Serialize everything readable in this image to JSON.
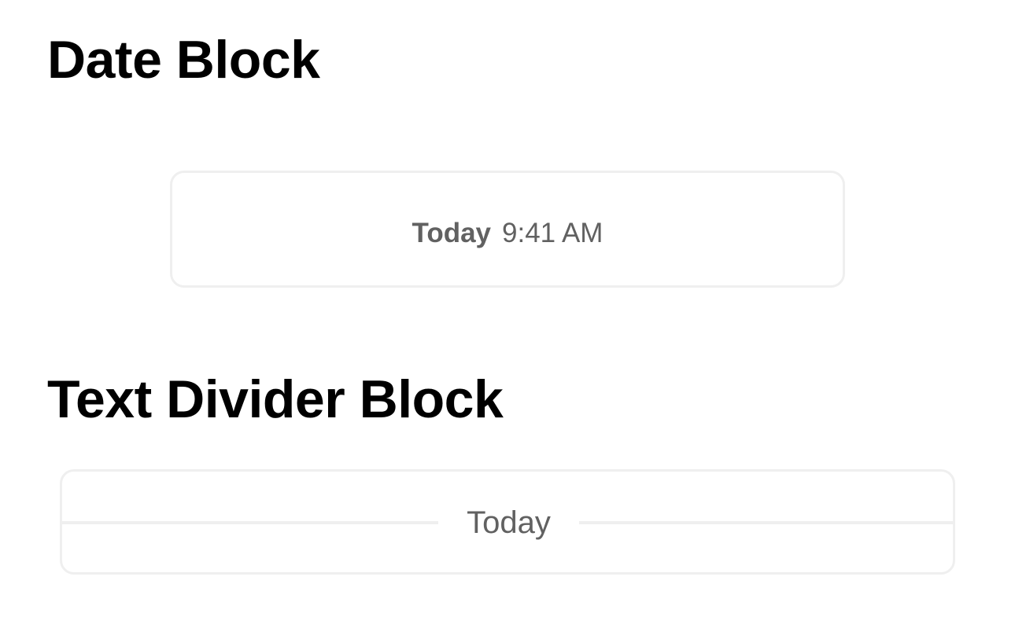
{
  "sections": {
    "date_block": {
      "title": "Date Block",
      "day": "Today",
      "time": "9:41 AM"
    },
    "text_divider_block": {
      "title": "Text Divider Block",
      "label": "Today"
    }
  },
  "colors": {
    "title_text": "#000000",
    "muted_text": "#616161",
    "border": "#efefef",
    "background": "#ffffff"
  }
}
